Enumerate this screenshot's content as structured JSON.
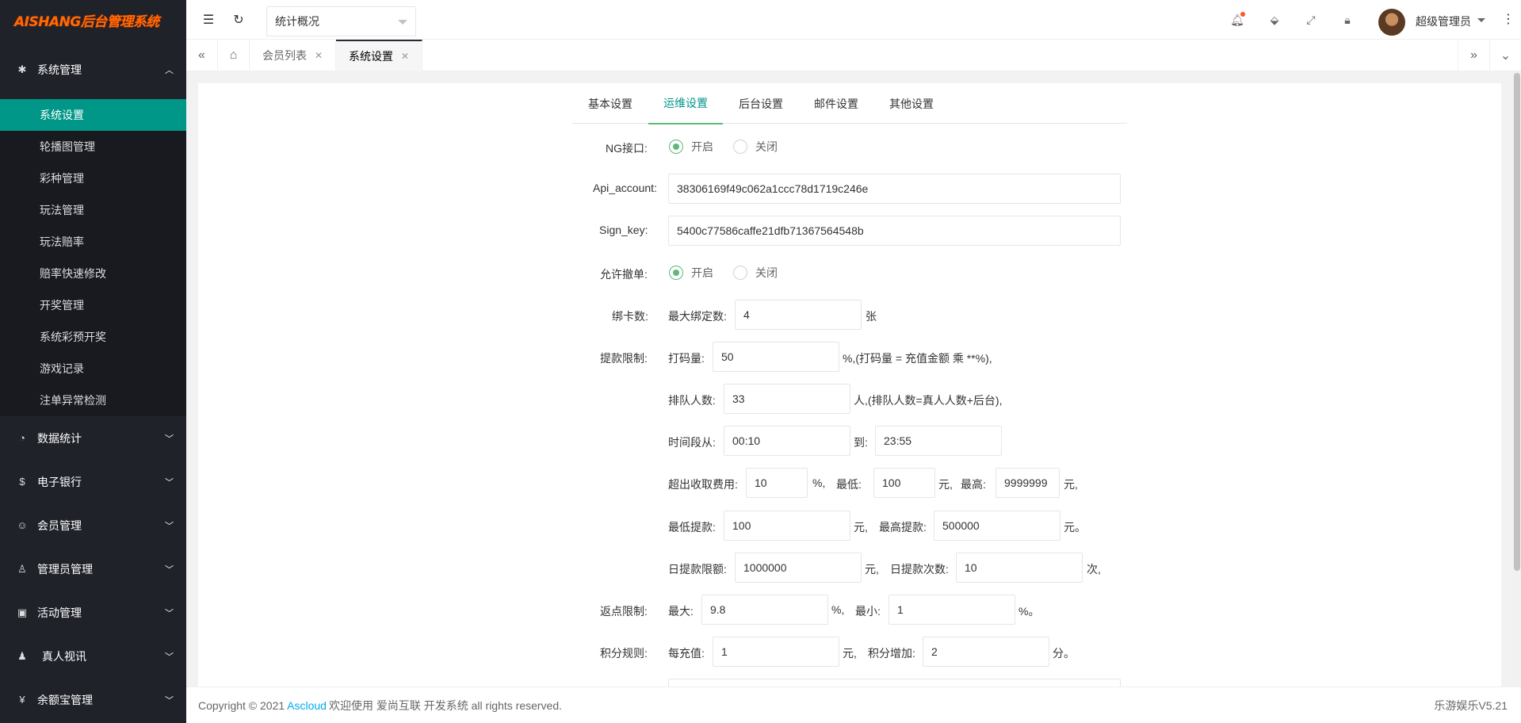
{
  "brand": {
    "logo_text": "AISHANG后台管理系统"
  },
  "sidebar": {
    "system_menu": {
      "label": "系统管理",
      "items": [
        {
          "label": "系统设置",
          "active": true
        },
        {
          "label": "轮播图管理"
        },
        {
          "label": "彩种管理"
        },
        {
          "label": "玩法管理"
        },
        {
          "label": "玩法赔率"
        },
        {
          "label": "赔率快速修改"
        },
        {
          "label": "开奖管理"
        },
        {
          "label": "系统彩预开奖"
        },
        {
          "label": "游戏记录"
        },
        {
          "label": "注单异常检测"
        }
      ]
    },
    "menus": [
      {
        "label": "数据统计",
        "icon": "dashboard-icon"
      },
      {
        "label": "电子银行",
        "icon": "dollar-icon"
      },
      {
        "label": "会员管理",
        "icon": "users-icon"
      },
      {
        "label": "管理员管理",
        "icon": "user-icon"
      },
      {
        "label": "活动管理",
        "icon": "gift-icon"
      },
      {
        "label": "真人视讯",
        "icon": "group-icon"
      },
      {
        "label": "余额宝管理",
        "icon": "yen-icon"
      }
    ]
  },
  "header": {
    "select_value": "统计概况",
    "user_name": "超级管理员"
  },
  "tabs": [
    {
      "label": "会员列表"
    },
    {
      "label": "系统设置",
      "active": true
    }
  ],
  "form_tabs": [
    "基本设置",
    "运维设置",
    "后台设置",
    "邮件设置",
    "其他设置"
  ],
  "form": {
    "ng": {
      "label": "NG接口:",
      "on": "开启",
      "off": "关闭"
    },
    "api_account": {
      "label": "Api_account:",
      "value": "38306169f49c062a1ccc78d1719c246e"
    },
    "sign_key": {
      "label": "Sign_key:",
      "value": "5400c77586caffe21dfb71367564548b"
    },
    "cancel": {
      "label": "允许撤单:",
      "on": "开启",
      "off": "关闭"
    },
    "bindcard": {
      "label": "绑卡数:",
      "sub": "最大绑定数:",
      "value": "4",
      "unit": "张"
    },
    "withdraw": {
      "label": "提款限制:",
      "bet_label": "打码量:",
      "bet_value": "50",
      "bet_note": "%,(打码量 = 充值金额 乘 **%),",
      "queue_label": "排队人数:",
      "queue_value": "33",
      "queue_note": "人,(排队人数=真人人数+后台),",
      "time_label": "时间段从:",
      "time_from": "00:10",
      "time_to_label": "到:",
      "time_to": "23:55",
      "fee_label": "超出收取费用:",
      "fee_value": "10",
      "fee_unit": "%,",
      "fee_min_label": "最低:",
      "fee_min": "100",
      "fee_min_unit": "元,",
      "fee_max_label": "最高:",
      "fee_max": "9999999",
      "fee_max_unit": "元,",
      "min_label": "最低提款:",
      "min_value": "100",
      "min_unit": "元,",
      "max_label": "最高提款:",
      "max_value": "500000",
      "max_unit": "元。",
      "daily_label": "日提款限额:",
      "daily_value": "1000000",
      "daily_unit": "元,",
      "times_label": "日提款次数:",
      "times_value": "10",
      "times_unit": "次,"
    },
    "rebate": {
      "label": "返点限制:",
      "max_label": "最大:",
      "max_value": "9.8",
      "max_unit": "%,",
      "min_label": "最小:",
      "min_value": "1",
      "min_unit": "%。"
    },
    "points": {
      "label": "积分规则:",
      "per_label": "每充值:",
      "per_value": "1",
      "per_unit": "元,",
      "add_label": "积分增加:",
      "add_value": "2",
      "add_unit": "分。"
    }
  },
  "footer": {
    "copyright": "Copyright © 2021",
    "link": "Ascloud",
    "text": "欢迎使用 爱尚互联 开发系统 all rights reserved.",
    "version": "乐游娱乐V5.21"
  },
  "colors": {
    "accent": "#009688",
    "radio": "#5fb878",
    "sidebar": "#20222a",
    "link": "#01aaed"
  }
}
